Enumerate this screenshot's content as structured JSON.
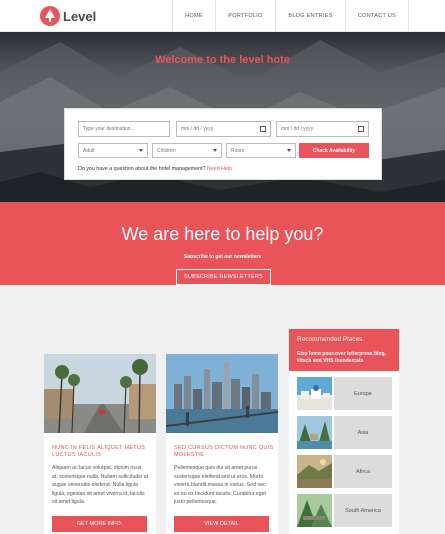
{
  "brand": {
    "name": "Level",
    "accent": "#e9535a"
  },
  "nav": {
    "items": [
      "HOME",
      "PORTFOLIO",
      "BLOG ENTRIES",
      "CONTACT US"
    ]
  },
  "hero": {
    "title": "Welcome to the level hote",
    "booking": {
      "destination_placeholder": "Type your destination...",
      "checkin": "mm / dd / yyyy",
      "checkout": "mm / dd / yyyy",
      "adult": "Adult",
      "children": "Children",
      "room": "Room",
      "check_button": "Check Availability",
      "question": "Do you have a question about the hotel management?",
      "help_link": "Need Help"
    }
  },
  "help": {
    "title": "We are here to help you?",
    "subtitle": "Subscribe to get our newsletters",
    "button": "SUBSCRIBE NEWSLETTERS"
  },
  "cards": [
    {
      "title": "NUNC IN FELIS ALIQUET METUS LUCTUS IACULIS",
      "text": "Aliquam ac lacus volutpat, dictum risus at, scelerisque nulla. Nullam sollicitudin at augue venenatis eleifend. Nulla ligula ligula, egestas sit amet viverra id, iaculis sit amet ligula.",
      "button": "GET MORE INFO."
    },
    {
      "title": "SED CURSUS DICTUM NUNC QUIS MOLESTIE",
      "text": "Pellentesque quis dui sit amet purus scelerisque eleifend sed ut eros. Morbi viverra blandit massa in varius. Sed nec ex eu ex tincidunt iaculis. Curabitur eget justo pellentesque.",
      "button": "VIEW DETAIL"
    }
  ],
  "recommended": {
    "title": "Recommended Places",
    "subtitle": "Etsy lomo pour-over letterpress blog, kitsch and VHS thundercats",
    "places": [
      "Europe",
      "Asia",
      "Africa",
      "South America"
    ]
  }
}
